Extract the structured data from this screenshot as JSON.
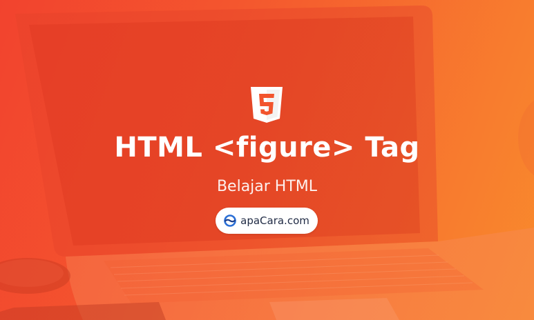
{
  "banner": {
    "logo_icon": "html5-icon",
    "title": "HTML <figure> Tag",
    "subtitle": "Belajar HTML",
    "site": {
      "icon": "apacara-logo-icon",
      "label": "apaCara.com"
    }
  },
  "colors": {
    "gradient_start": "#f2452e",
    "gradient_end": "#f98a2c",
    "text": "#ffffff",
    "pill_background": "#ffffff",
    "pill_text": "#1f2a44",
    "site_icon": "#2b6fd6"
  }
}
